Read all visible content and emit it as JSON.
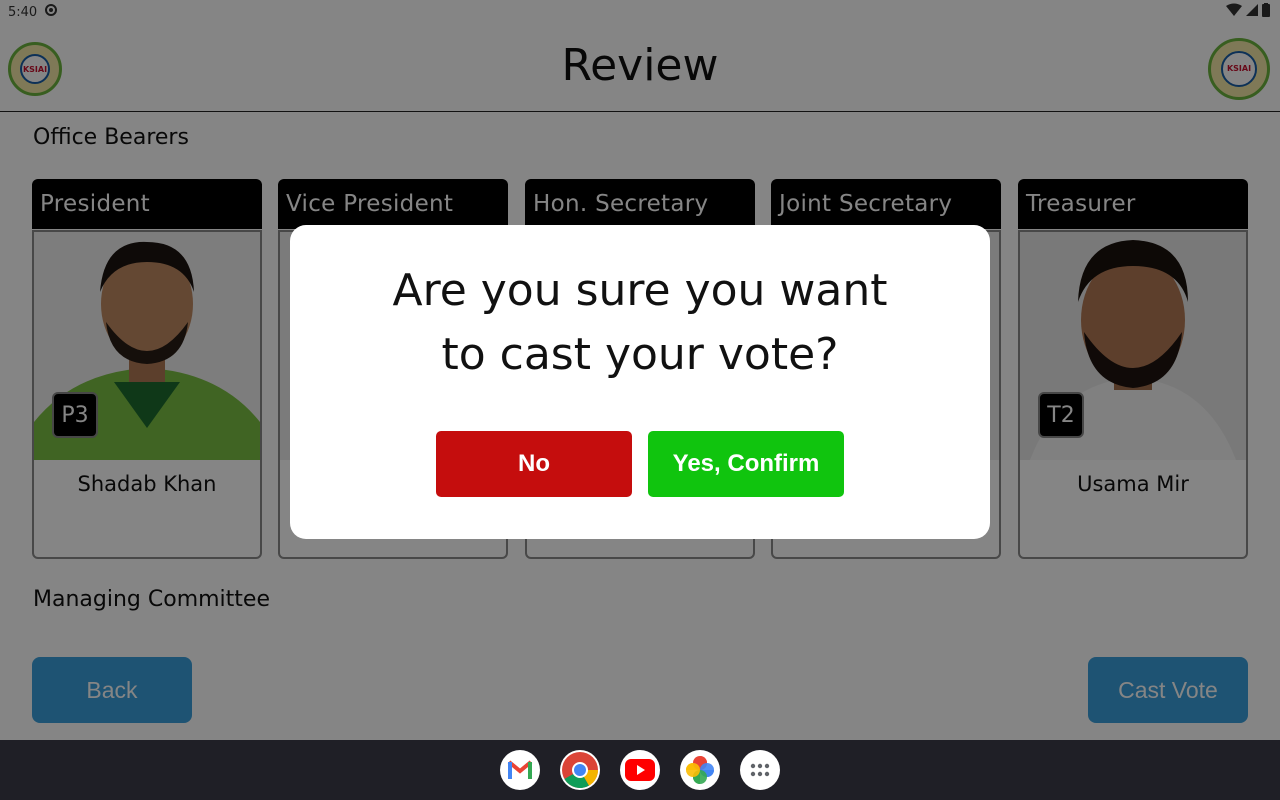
{
  "status_bar": {
    "time": "5:40"
  },
  "header": {
    "title": "Review"
  },
  "sections": {
    "office_bearers": "Office Bearers",
    "managing_committee": "Managing Committee"
  },
  "positions": [
    {
      "title": "President",
      "badge": "P3",
      "name": "Shadab Khan"
    },
    {
      "title": "Vice President"
    },
    {
      "title": "Hon. Secretary"
    },
    {
      "title": "Joint Secretary"
    },
    {
      "title": "Treasurer",
      "badge": "T2",
      "name": "Usama Mir"
    }
  ],
  "buttons": {
    "back": "Back",
    "cast_vote": "Cast Vote"
  },
  "dialog": {
    "message": "Are you sure you want to cast your vote?",
    "no": "No",
    "yes": "Yes, Confirm"
  },
  "colors": {
    "primary_button": "#3aa0dc",
    "no_button": "#c50d0d",
    "yes_button": "#10c40e",
    "card_header": "#000000"
  },
  "nav_apps": [
    "gmail-icon",
    "chrome-icon",
    "youtube-icon",
    "photos-icon",
    "app-drawer-icon"
  ]
}
